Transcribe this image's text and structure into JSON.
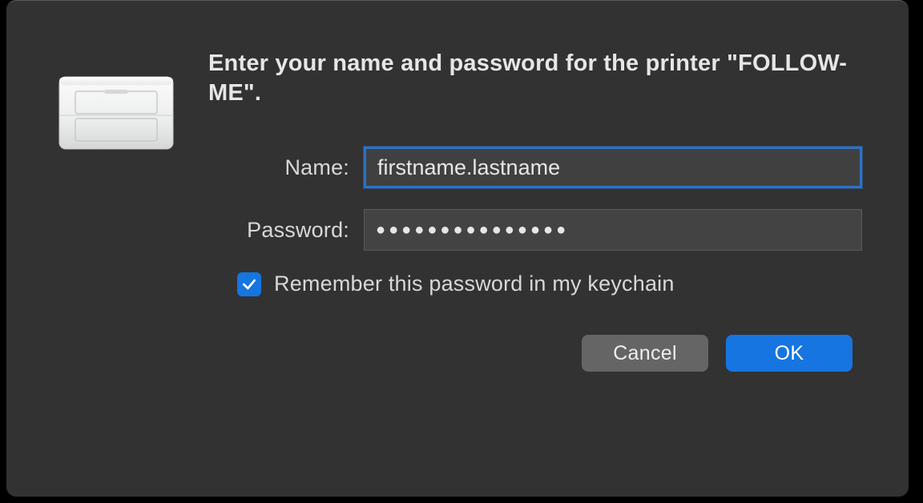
{
  "dialog": {
    "prompt": "Enter your name and password for the printer \"FOLLOW-ME\".",
    "name_label": "Name:",
    "name_value": "firstname.lastname",
    "password_label": "Password:",
    "password_value": "●●●●●●●●●●●●●●●",
    "remember_checked": true,
    "remember_label": "Remember this password in my keychain",
    "cancel_label": "Cancel",
    "ok_label": "OK"
  }
}
